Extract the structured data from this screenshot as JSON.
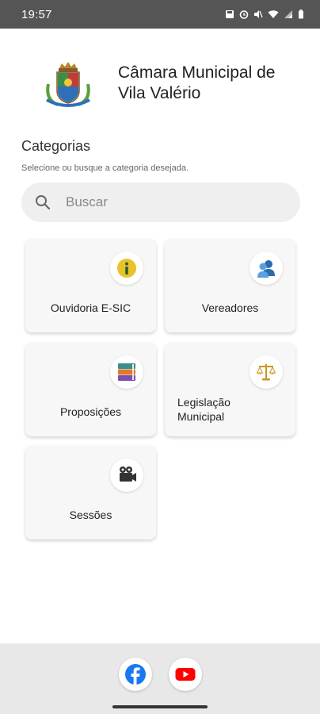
{
  "status_bar": {
    "time": "19:57"
  },
  "header": {
    "title_line1": "Câmara Municipal de",
    "title_line2": "Vila Valério"
  },
  "categories": {
    "title": "Categorias",
    "subtitle": "Selecione ou busque a categoria desejada."
  },
  "search": {
    "placeholder": "Buscar"
  },
  "cards": [
    {
      "label": "Ouvidoria E-SIC",
      "icon": "info-icon"
    },
    {
      "label": "Vereadores",
      "icon": "users-icon"
    },
    {
      "label": "Proposições",
      "icon": "books-icon"
    },
    {
      "label_line1": "Legislação",
      "label_line2": "Municipal",
      "icon": "scales-icon"
    },
    {
      "label": "Sessões",
      "icon": "video-camera-icon"
    }
  ],
  "footer": {
    "links": [
      {
        "icon": "facebook-icon"
      },
      {
        "icon": "youtube-icon"
      }
    ]
  },
  "colors": {
    "status_bar": "#555555",
    "card_bg": "#f7f7f7",
    "search_bg": "#efefef",
    "footer_bg": "#e8e8e8",
    "facebook": "#1877f2",
    "youtube": "#ff0000"
  }
}
